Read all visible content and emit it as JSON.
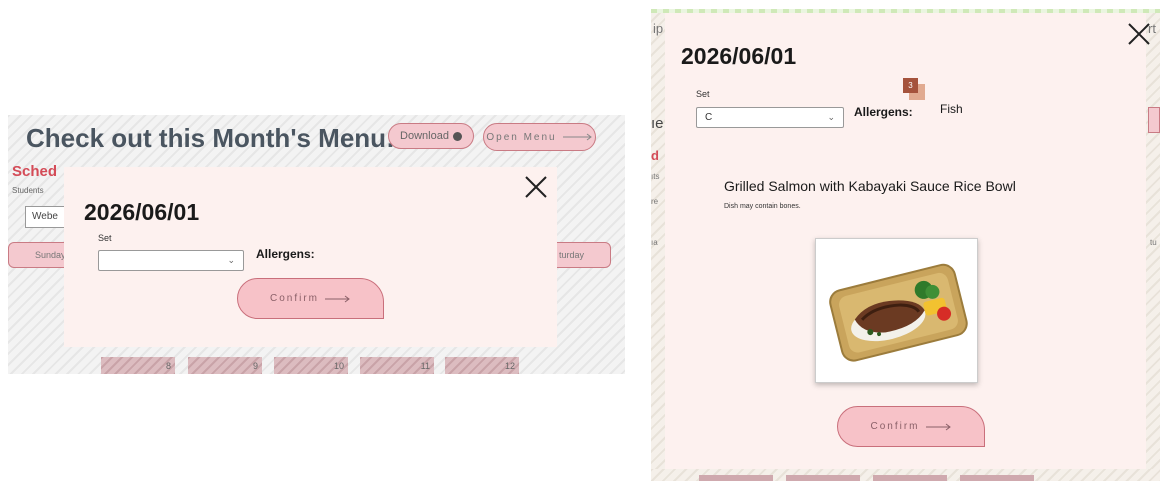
{
  "left": {
    "header": {
      "title": "Check out this Month's Menu:",
      "download_label": "Download",
      "open_menu_label": "Open Menu"
    },
    "schedule_label": "Sched",
    "students_label": "Students",
    "student_select_value": "Webe",
    "weekday_first": "Sunday",
    "weekday_last": "turday",
    "calendar_days": [
      "8",
      "9",
      "10",
      "11",
      "12"
    ],
    "modal": {
      "date": "2026/06/01",
      "set_label": "Set",
      "set_value": "",
      "allergens_label": "Allergens:",
      "confirm_label": "Confirm"
    }
  },
  "right": {
    "modal": {
      "date": "2026/06/01",
      "set_label": "Set",
      "set_value": "C",
      "allergens_label": "Allergens:",
      "allergens_value": "Fish",
      "allergen_badge": "3",
      "dish_name": "Grilled Salmon with Kabayaki Sauce Rice Bowl",
      "dish_note": "Dish may contain bones.",
      "confirm_label": "Confirm"
    },
    "background_fragments": {
      "left_edge": [
        "ip",
        "ıe",
        "d",
        "ıts",
        "re",
        "ıa"
      ],
      "right_edge": [
        "rt",
        "tu"
      ]
    }
  },
  "colors": {
    "accent_pink": "#f7c2c8",
    "accent_border": "#c96f7b",
    "modal_bg": "#fdf1ef",
    "schedule_red": "#d44b57",
    "title_gray": "#4a5560"
  },
  "icons": [
    "close-icon",
    "chevron-down-icon",
    "arrow-right-icon",
    "info-dot-icon"
  ]
}
